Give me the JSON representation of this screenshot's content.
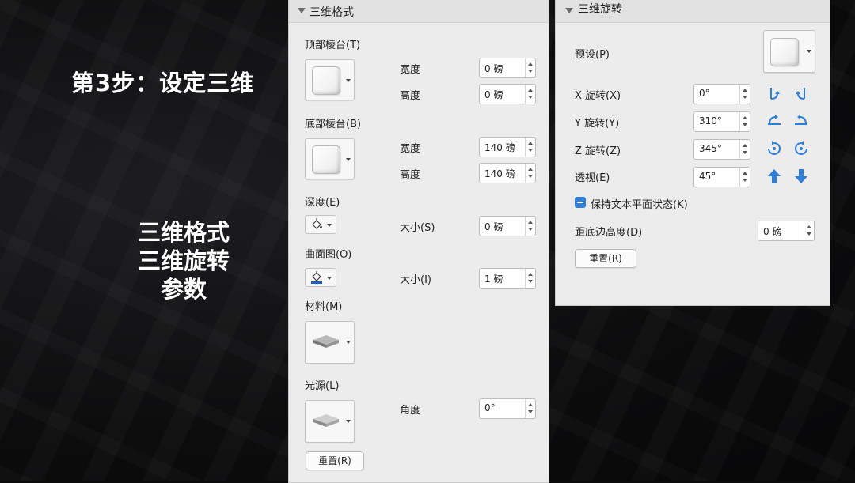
{
  "slide": {
    "step_title": "第3步：设定三维",
    "desc_lines": [
      "三维格式",
      "三维旋转",
      "参数"
    ]
  },
  "format_panel": {
    "title": "三维格式",
    "top_bevel": {
      "label": "顶部棱台(T)",
      "width_label": "宽度",
      "width_value": "0 磅",
      "height_label": "高度",
      "height_value": "0 磅"
    },
    "bottom_bevel": {
      "label": "底部棱台(B)",
      "width_label": "宽度",
      "width_value": "140 磅",
      "height_label": "高度",
      "height_value": "140 磅"
    },
    "depth": {
      "label": "深度(E)",
      "size_label": "大小(S)",
      "size_value": "0 磅"
    },
    "contour": {
      "label": "曲面图(O)",
      "size_label": "大小(I)",
      "size_value": "1 磅",
      "color": "#1f5fbf"
    },
    "material": {
      "label": "材料(M)"
    },
    "lighting": {
      "label": "光源(L)",
      "angle_label": "角度",
      "angle_value": "0°"
    },
    "reset_label": "重置(R)"
  },
  "rotation_panel": {
    "title": "三维旋转",
    "preset_label": "预设(P)",
    "x_rotation": {
      "label": "X 旋转(X)",
      "value": "0°"
    },
    "y_rotation": {
      "label": "Y 旋转(Y)",
      "value": "310°"
    },
    "z_rotation": {
      "label": "Z 旋转(Z)",
      "value": "345°"
    },
    "perspective": {
      "label": "透视(E)",
      "value": "45°"
    },
    "keep_text_flat": {
      "label": "保持文本平面状态(K)",
      "checked": "mixed"
    },
    "distance": {
      "label": "距底边高度(D)",
      "value": "0 磅"
    },
    "reset_label": "重置(R)",
    "icon_color": "#2f7fd8",
    "icons": [
      "rotate-left-x-icon",
      "rotate-right-x-icon",
      "rotate-up-y-icon",
      "rotate-down-y-icon",
      "rotate-counterclockwise-z-icon",
      "rotate-clockwise-z-icon",
      "perspective-increase-icon",
      "perspective-decrease-icon"
    ]
  }
}
